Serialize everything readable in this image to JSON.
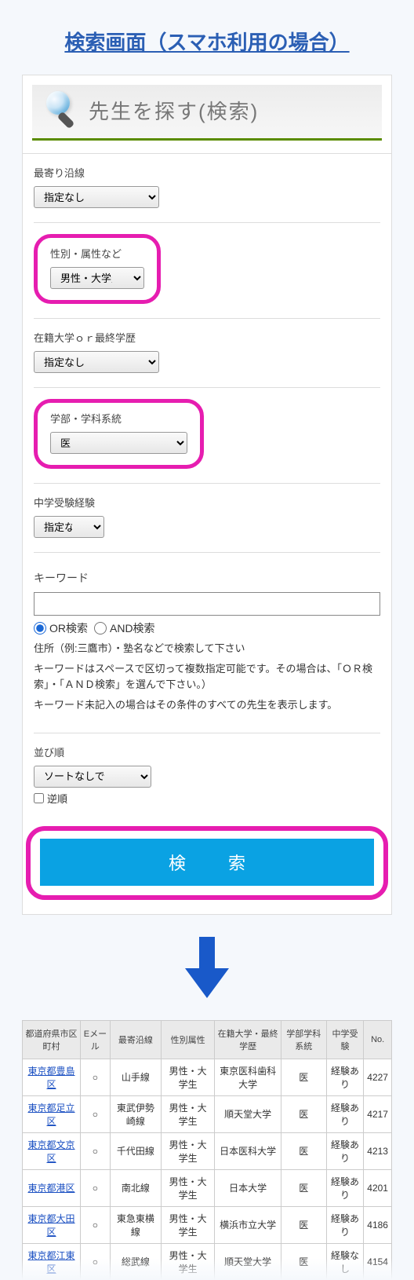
{
  "title": "検索画面（スマホ利用の場合）",
  "hero": "先生を探す(検索)",
  "labels": {
    "route": "最寄り沿線",
    "attribute": "性別・属性など",
    "university": "在籍大学ｏｒ最終学歴",
    "department": "学部・学科系統",
    "exam": "中学受験経験",
    "keyword": "キーワード",
    "sort": "並び順",
    "reverse": "逆順"
  },
  "values": {
    "route": "指定なし",
    "attribute": "男性・大学生",
    "university": "指定なし",
    "department": "医",
    "exam": "指定なし",
    "sort": "ソートなしで"
  },
  "radio": {
    "or": "OR検索",
    "and": "AND検索"
  },
  "notes": {
    "n1": "住所（例:三鷹市）・塾名などで検索して下さい",
    "n2": "キーワードはスペースで区切って複数指定可能です。その場合は、「ＯＲ検索」・「ＡＮＤ検索」を選んで下さい。）",
    "n3": "キーワード未記入の場合はその条件のすべての先生を表示します。"
  },
  "searchBtn": "検 索",
  "table": {
    "headers": [
      "都道府県市区町村",
      "Eメール",
      "最寄沿線",
      "性別属性",
      "在籍大学・最終学歴",
      "学部学科系統",
      "中学受験",
      "No."
    ],
    "rows": [
      {
        "area": "東京都豊島区",
        "email": "○",
        "line": "山手線",
        "attr": "男性・大学生",
        "univ": "東京医科歯科大学",
        "dept": "医",
        "exam": "経験あり",
        "no": "4227"
      },
      {
        "area": "東京都足立区",
        "email": "○",
        "line": "東武伊勢崎線",
        "attr": "男性・大学生",
        "univ": "順天堂大学",
        "dept": "医",
        "exam": "経験あり",
        "no": "4217"
      },
      {
        "area": "東京都文京区",
        "email": "○",
        "line": "千代田線",
        "attr": "男性・大学生",
        "univ": "日本医科大学",
        "dept": "医",
        "exam": "経験あり",
        "no": "4213"
      },
      {
        "area": "東京都港区",
        "email": "○",
        "line": "南北線",
        "attr": "男性・大学生",
        "univ": "日本大学",
        "dept": "医",
        "exam": "経験あり",
        "no": "4201"
      },
      {
        "area": "東京都大田区",
        "email": "○",
        "line": "東急東横線",
        "attr": "男性・大学生",
        "univ": "横浜市立大学",
        "dept": "医",
        "exam": "経験あり",
        "no": "4186"
      },
      {
        "area": "東京都江東区",
        "email": "○",
        "line": "総武線",
        "attr": "男性・大学生",
        "univ": "順天堂大学",
        "dept": "医",
        "exam": "経験なし",
        "no": "4154"
      }
    ]
  }
}
